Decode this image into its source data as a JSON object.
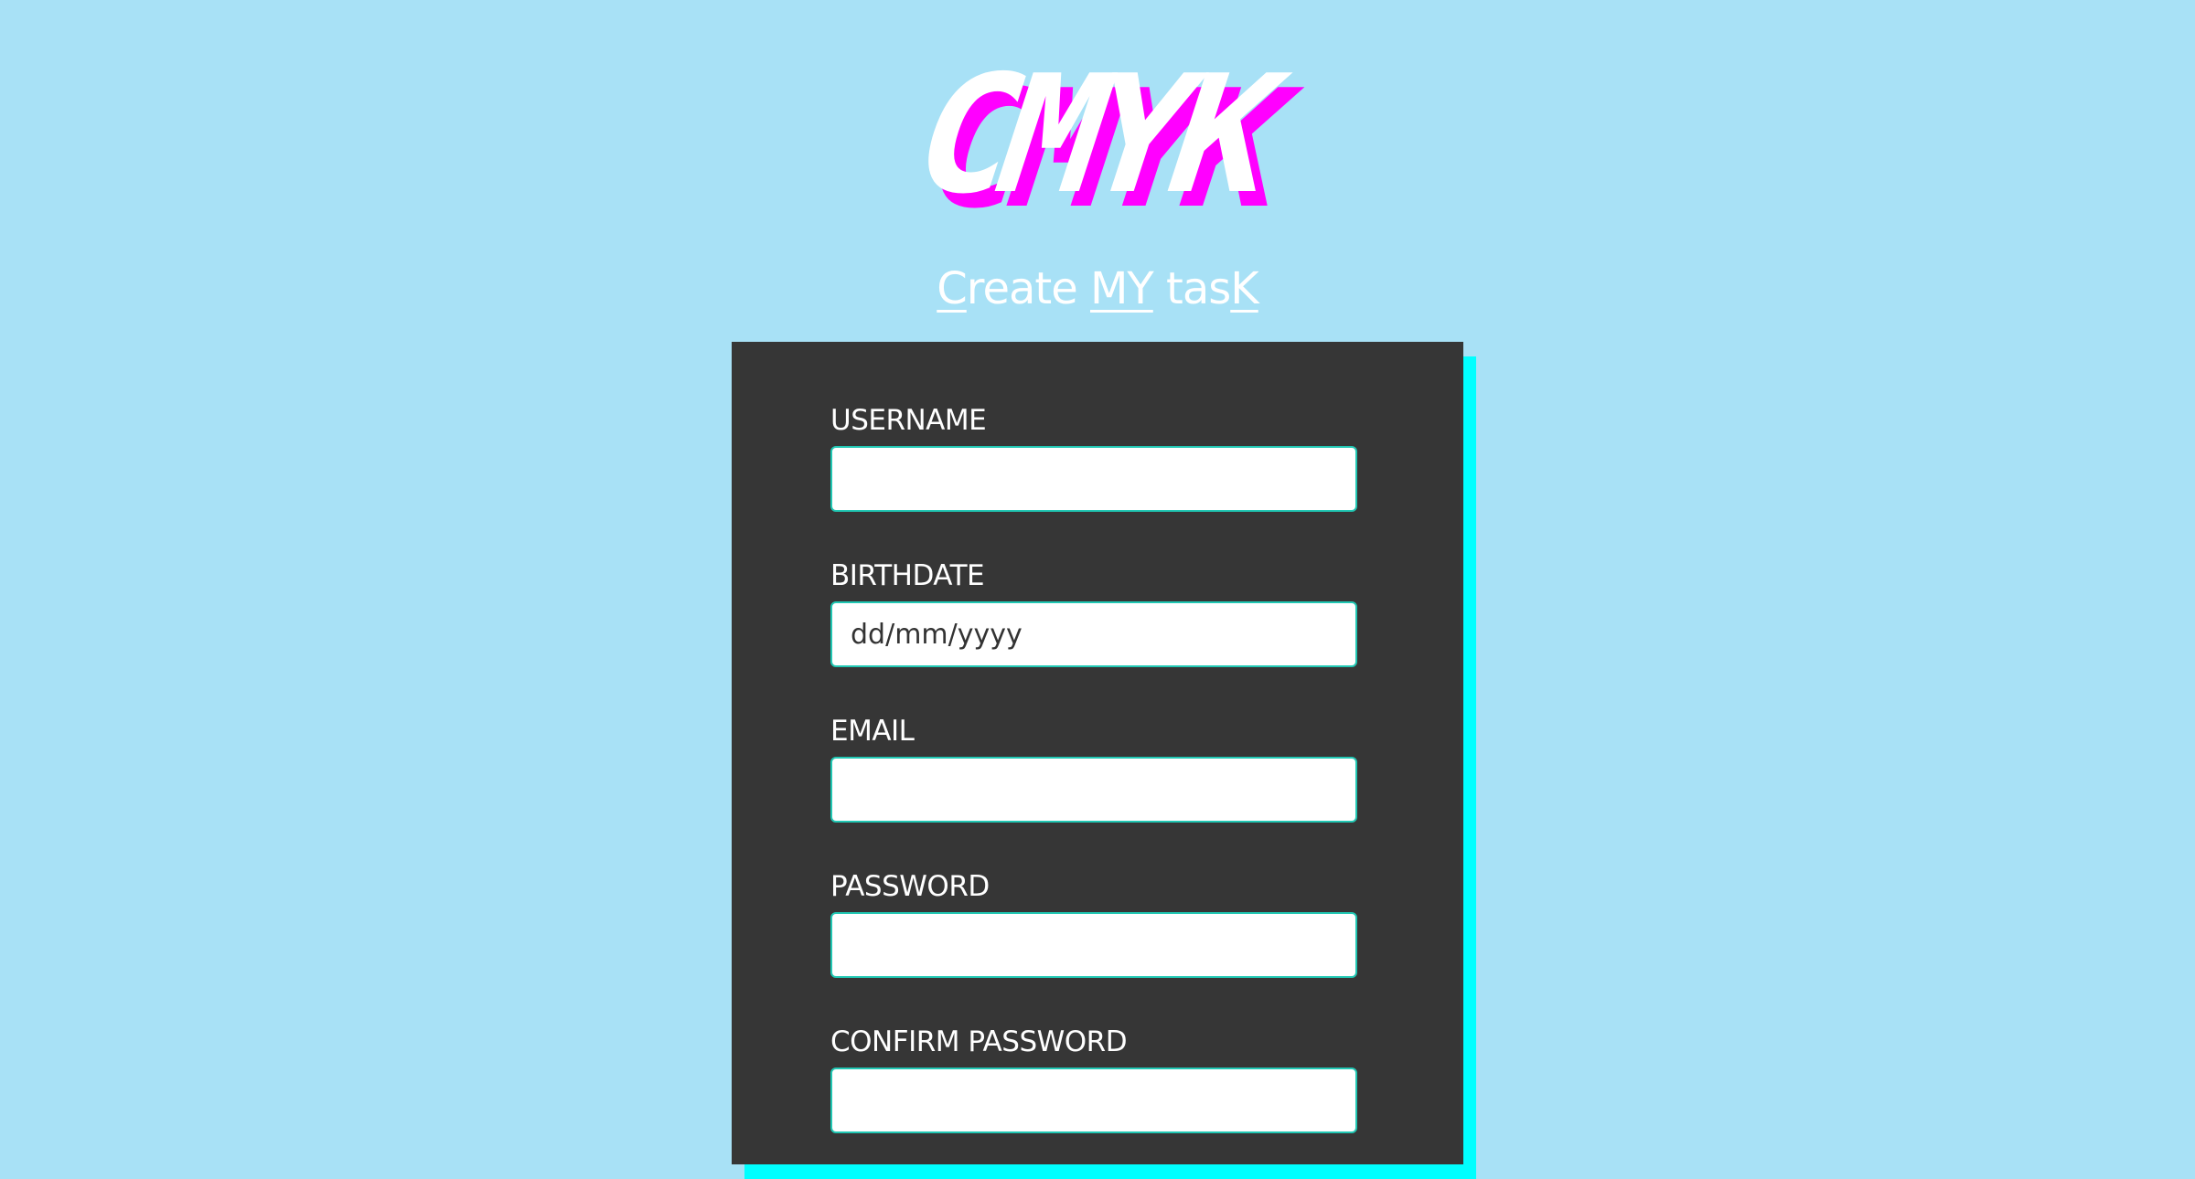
{
  "logo": {
    "text": "CMYK",
    "fill_color": "#ffffff",
    "offset_color": "#ff00ff"
  },
  "tagline": {
    "parts": [
      "C",
      "reate ",
      "MY",
      " tas",
      "K"
    ]
  },
  "form": {
    "fields": [
      {
        "label": "USERNAME",
        "value": "",
        "placeholder": ""
      },
      {
        "label": "BIRTHDATE",
        "value": "",
        "placeholder": "dd/mm/yyyy"
      },
      {
        "label": "EMAIL",
        "value": "",
        "placeholder": ""
      },
      {
        "label": "PASSWORD",
        "value": "",
        "placeholder": ""
      },
      {
        "label": "CONFIRM PASSWORD",
        "value": "",
        "placeholder": ""
      }
    ]
  },
  "colors": {
    "background": "#a8e1f6",
    "card": "#363636",
    "card_shadow": "#00ffff",
    "input_border": "#21c8b4"
  }
}
